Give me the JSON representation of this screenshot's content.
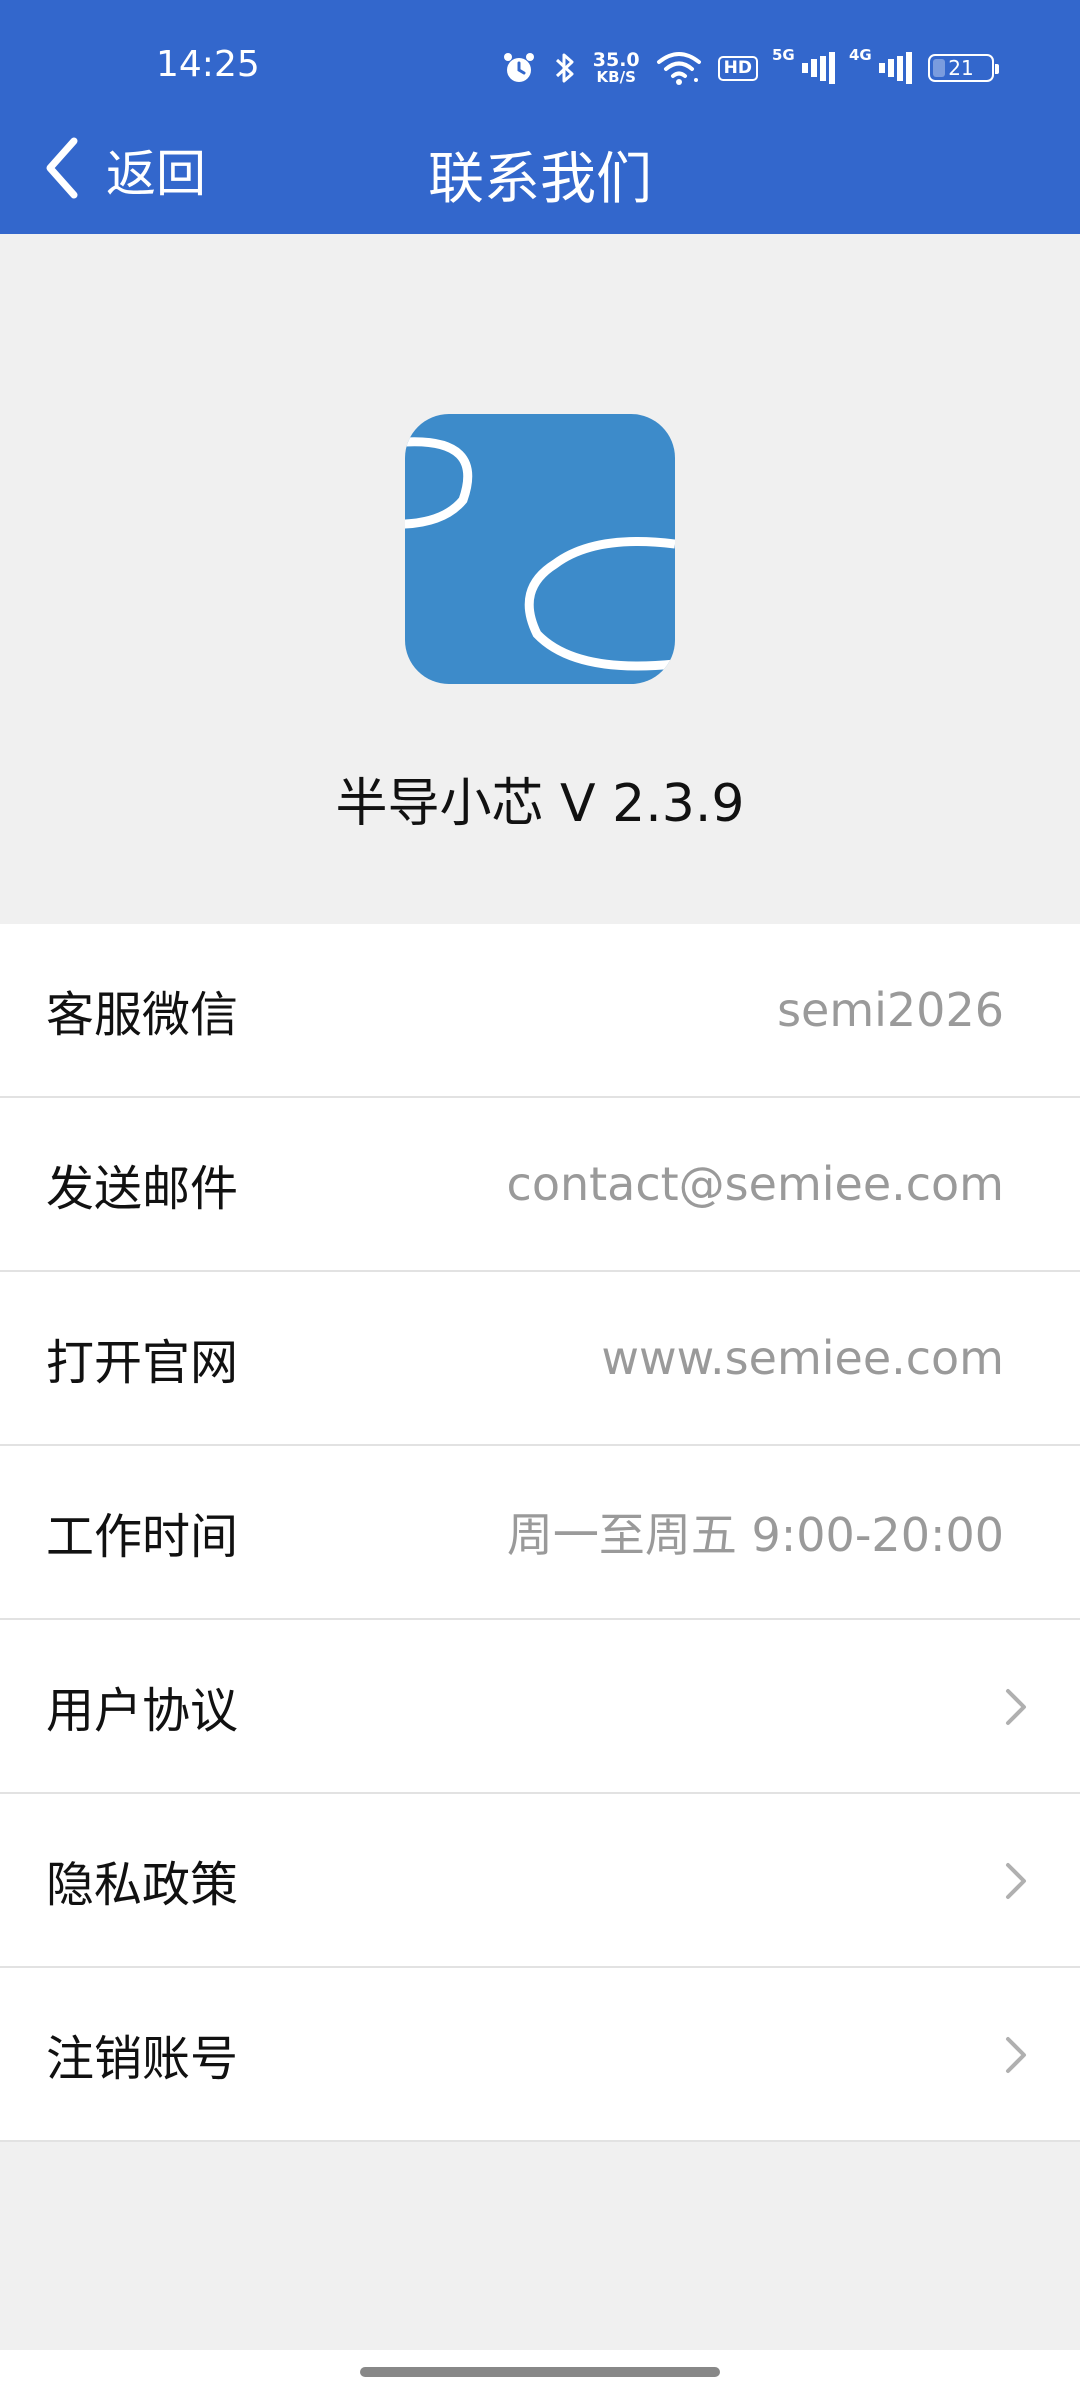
{
  "status_bar": {
    "time": "14:25",
    "net_speed_value": "35.0",
    "net_speed_unit": "KB/S",
    "hd_badge": "HD",
    "signal1_tag": "5G",
    "signal2_tag": "4G",
    "battery_level": "21",
    "icons": [
      "alarm-icon",
      "bluetooth-icon",
      "wifi-icon",
      "hd-icon",
      "signal-icon",
      "signal-icon",
      "battery-icon"
    ]
  },
  "header": {
    "back_label": "返回",
    "title": "联系我们",
    "background_color": "#3367cc"
  },
  "app": {
    "version_text": "半导小芯 V 2.3.9",
    "logo_color": "#3d8bca"
  },
  "list": [
    {
      "label": "客服微信",
      "value": "semi2026"
    },
    {
      "label": "发送邮件",
      "value": "contact@semiee.com"
    },
    {
      "label": "打开官网",
      "value": "www.semiee.com"
    },
    {
      "label": "工作时间",
      "value": "周一至周五 9:00-20:00"
    },
    {
      "label": "用户协议",
      "value": ""
    },
    {
      "label": "隐私政策",
      "value": ""
    },
    {
      "label": "注销账号",
      "value": ""
    }
  ]
}
